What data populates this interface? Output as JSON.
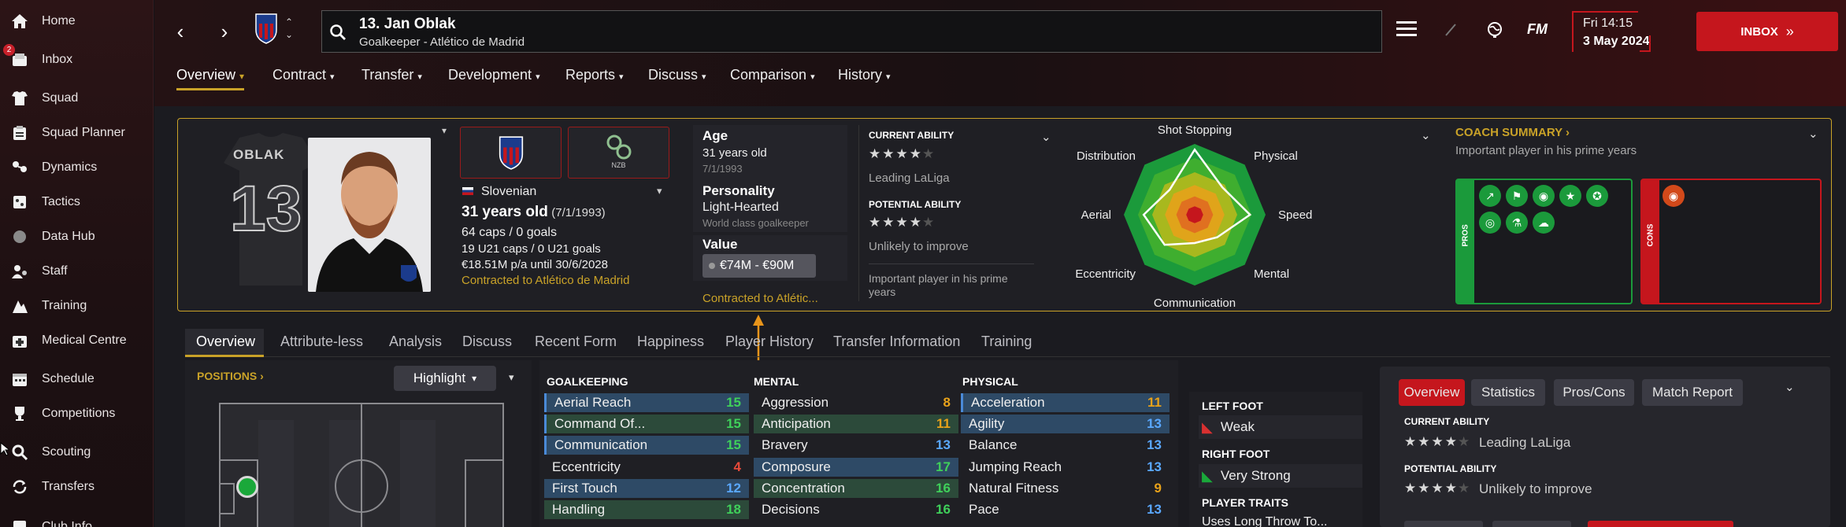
{
  "sidebar": {
    "items": [
      {
        "label": "Home",
        "icon": "home-icon",
        "badge": ""
      },
      {
        "label": "Inbox",
        "icon": "inbox-icon",
        "badge": "2"
      },
      {
        "label": "Squad",
        "icon": "squad-icon",
        "badge": ""
      },
      {
        "label": "Squad Planner",
        "icon": "clipboard-icon",
        "badge": ""
      },
      {
        "label": "Dynamics",
        "icon": "dynamics-icon",
        "badge": ""
      },
      {
        "label": "Tactics",
        "icon": "tactics-icon",
        "badge": ""
      },
      {
        "label": "Data Hub",
        "icon": "data-hub-icon",
        "badge": ""
      },
      {
        "label": "Staff",
        "icon": "staff-icon",
        "badge": ""
      },
      {
        "label": "Training",
        "icon": "training-icon",
        "badge": ""
      },
      {
        "label": "Medical Centre",
        "icon": "medical-icon",
        "badge": ""
      },
      {
        "label": "Schedule",
        "icon": "calendar-icon",
        "badge": ""
      },
      {
        "label": "Competitions",
        "icon": "trophy-icon",
        "badge": ""
      },
      {
        "label": "Scouting",
        "icon": "scouting-icon",
        "badge": ""
      },
      {
        "label": "Transfers",
        "icon": "transfers-icon",
        "badge": ""
      },
      {
        "label": "Club Info",
        "icon": "club-info-icon",
        "badge": ""
      }
    ]
  },
  "header": {
    "player_title": "13. Jan Oblak",
    "player_subtitle": "Goalkeeper - Atlético de Madrid",
    "date_day": "Fri 14:15",
    "date_full": "3 May 2024",
    "inbox_label": "INBOX",
    "fm_label": "FM",
    "tabs": [
      "Overview",
      "Contract",
      "Transfer",
      "Development",
      "Reports",
      "Discuss",
      "Comparison",
      "History"
    ]
  },
  "profile": {
    "shirt_name": "OBLAK",
    "shirt_number": "13",
    "club_badge_short": "NZB",
    "nationality": "Slovenian",
    "age_line": "31 years old",
    "dob_paren": "(7/1/1993)",
    "caps": "64 caps / 0 goals",
    "u21_caps": "19 U21 caps / 0 U21 goals",
    "wage": "€18.51M p/a until 30/6/2028",
    "contract": "Contracted to Atlético de Madrid"
  },
  "details": {
    "age_label": "Age",
    "age_value": "31 years old",
    "age_dob": "7/1/1993",
    "personality_label": "Personality",
    "personality_value": "Light-Hearted",
    "personality_sub": "World class goalkeeper",
    "value_label": "Value",
    "value_amount": "€74M - €90M",
    "contract_short": "Contracted to Atlétic..."
  },
  "ability": {
    "current_label": "CURRENT ABILITY",
    "current_stars": "★★★★",
    "current_text": "Leading LaLiga",
    "potential_label": "POTENTIAL ABILITY",
    "potential_stars": "★★★★",
    "potential_text": "Unlikely to improve",
    "note": "Important player in his prime years"
  },
  "radar": {
    "labels": [
      "Shot Stopping",
      "Physical",
      "Speed",
      "Mental",
      "Communication",
      "Eccentricity",
      "Aerial",
      "Distribution"
    ],
    "player_values": [
      0.92,
      0.55,
      0.78,
      0.45,
      0.4,
      0.6,
      0.72,
      0.5
    ]
  },
  "coach_summary": {
    "title": "COACH SUMMARY",
    "text": "Important player in his prime years",
    "pros_label": "PROS",
    "cons_label": "CONS",
    "pros_icons": [
      "kicking-icon",
      "flag-icon",
      "ball-plus-icon",
      "star-icon",
      "ball-icon",
      "target-icon",
      "flask-icon",
      "brain-icon"
    ],
    "cons_icons": [
      "ball-minus-icon"
    ]
  },
  "subtabs": [
    "Overview",
    "Attribute-less",
    "Analysis",
    "Discuss",
    "Recent Form",
    "Happiness",
    "Player History",
    "Transfer Information",
    "Training"
  ],
  "positions": {
    "title": "POSITIONS",
    "highlight_label": "Highlight"
  },
  "attributes": {
    "goalkeeping": {
      "title": "GOALKEEPING",
      "rows": [
        {
          "name": "Aerial Reach",
          "value": "15"
        },
        {
          "name": "Command Of...",
          "value": "15"
        },
        {
          "name": "Communication",
          "value": "15"
        },
        {
          "name": "Eccentricity",
          "value": "4"
        },
        {
          "name": "First Touch",
          "value": "12"
        },
        {
          "name": "Handling",
          "value": "18"
        }
      ]
    },
    "mental": {
      "title": "MENTAL",
      "rows": [
        {
          "name": "Aggression",
          "value": "8"
        },
        {
          "name": "Anticipation",
          "value": "11"
        },
        {
          "name": "Bravery",
          "value": "13"
        },
        {
          "name": "Composure",
          "value": "17"
        },
        {
          "name": "Concentration",
          "value": "16"
        },
        {
          "name": "Decisions",
          "value": "16"
        }
      ]
    },
    "physical": {
      "title": "PHYSICAL",
      "rows": [
        {
          "name": "Acceleration",
          "value": "11"
        },
        {
          "name": "Agility",
          "value": "13"
        },
        {
          "name": "Balance",
          "value": "13"
        },
        {
          "name": "Jumping Reach",
          "value": "13"
        },
        {
          "name": "Natural Fitness",
          "value": "9"
        },
        {
          "name": "Pace",
          "value": "13"
        }
      ]
    }
  },
  "feet": {
    "left_label": "LEFT FOOT",
    "left_value": "Weak",
    "right_label": "RIGHT FOOT",
    "right_value": "Very Strong",
    "traits_label": "PLAYER TRAITS",
    "traits_value": "Uses Long Throw To..."
  },
  "overview_panel": {
    "tabs": [
      "Overview",
      "Statistics",
      "Pros/Cons",
      "Match Report"
    ],
    "current_label": "CURRENT ABILITY",
    "current_stars": "★★★★",
    "current_text": "Leading LaLiga",
    "potential_label": "POTENTIAL ABILITY",
    "potential_stars": "★★★★",
    "potential_text": "Unlikely to improve"
  },
  "colors": {
    "accent": "#c9a228",
    "brand_red": "#c5161d",
    "pros_green": "#1b9a3b",
    "cons_red": "#c5161d",
    "selected_row": "#2e4a66"
  }
}
